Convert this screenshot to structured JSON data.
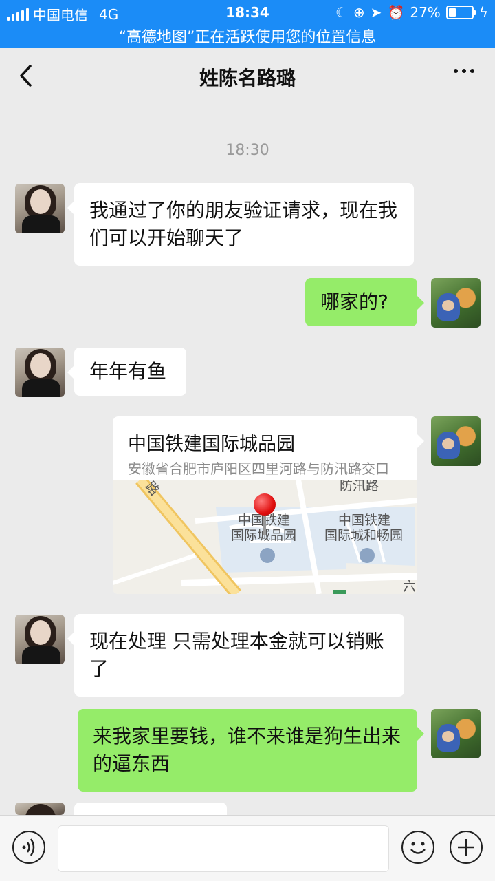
{
  "status_bar": {
    "carrier": "中国电信",
    "network": "4G",
    "time": "18:34",
    "battery": "27%",
    "battery_level": 0.27,
    "notice": "“高德地图”正在活跃使用您的位置信息",
    "bg_color": "#1b8cf7"
  },
  "nav": {
    "title": "姓陈名路璐",
    "back_icon": "chevron-left-icon",
    "more_icon": "ellipsis-icon"
  },
  "chat": {
    "timestamp": "18:30",
    "messages": [
      {
        "from": "contact",
        "text": "我通过了你的朋友验证请求，现在我们可以开始聊天了"
      },
      {
        "from": "me",
        "text": "哪家的?"
      },
      {
        "from": "contact",
        "text": "年年有鱼"
      },
      {
        "from": "me",
        "type": "location",
        "title": "中国铁建国际城品园",
        "address": "安徽省合肥市庐阳区四里河路与防汛路交口",
        "map_labels": [
          "路",
          "防汛路",
          "中国铁建",
          "国际城品园",
          "中国铁建",
          "国际城和畅园",
          "六"
        ]
      },
      {
        "from": "contact",
        "text": "现在处理  只需处理本金就可以销账了"
      },
      {
        "from": "me",
        "text": "来我家里要钱，谁不来谁是狗生出来的逼东西"
      }
    ],
    "outgoing_color": "#95ec69"
  },
  "input_bar": {
    "voice_icon": "voice-icon",
    "emoji_icon": "emoji-icon",
    "plus_icon": "plus-icon",
    "text_value": ""
  }
}
